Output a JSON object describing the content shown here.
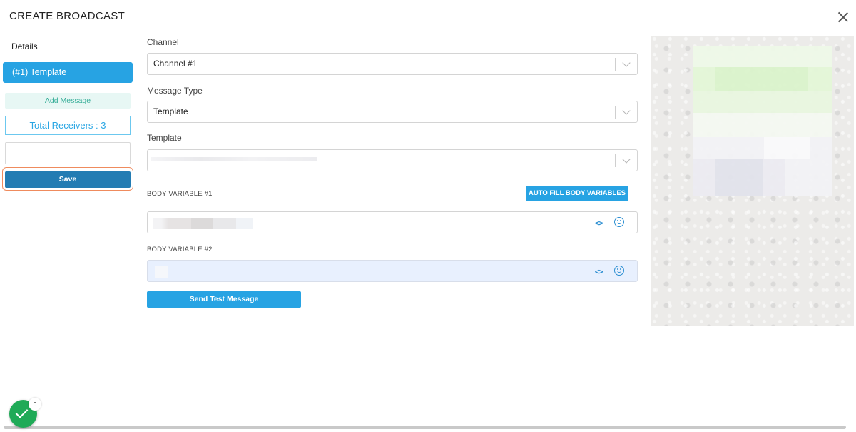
{
  "modal": {
    "title": "CREATE BROADCAST"
  },
  "sidebar": {
    "details_label": "Details",
    "template_item": "(#1) Template",
    "add_message": "Add Message",
    "total_receivers": "Total Receivers : 3",
    "name_input_value": "",
    "save_label": "Save"
  },
  "form": {
    "channel": {
      "label": "Channel",
      "value": "Channel #1"
    },
    "message_type": {
      "label": "Message Type",
      "value": "Template"
    },
    "template": {
      "label": "Template",
      "value": ""
    },
    "body_variable_1": {
      "label": "BODY VARIABLE #1",
      "value": ""
    },
    "body_variable_2": {
      "label": "BODY VARIABLE #2",
      "value": ""
    },
    "autofill_label": "AUTO FILL BODY VARIABLES",
    "send_test_label": "Send Test Message"
  },
  "status": {
    "badge_count": "0"
  },
  "colors": {
    "accent": "#27a3e3",
    "save": "#237cb3",
    "success": "#1faa57",
    "highlight_ring": "#ef8b5d"
  }
}
